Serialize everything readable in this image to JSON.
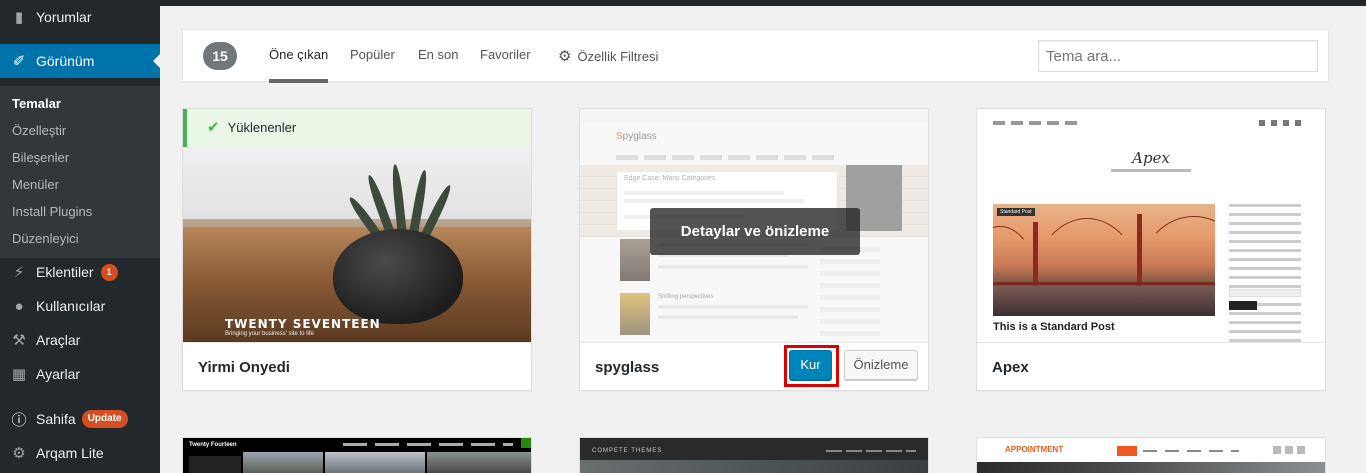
{
  "sidebar": {
    "comments": "Yorumlar",
    "appearance": "Görünüm",
    "appearance_sub": [
      "Temalar",
      "Özelleştir",
      "Bileşenler",
      "Menüler",
      "Install Plugins",
      "Düzenleyici"
    ],
    "plugins": "Eklentiler",
    "plugins_count": "1",
    "users": "Kullanıcılar",
    "tools": "Araçlar",
    "settings": "Ayarlar",
    "sahifa": "Sahifa",
    "sahifa_badge": "Update",
    "arqam": "Arqam Lite"
  },
  "filter": {
    "count": "15",
    "tabs": [
      "Öne çıkan",
      "Popüler",
      "En son",
      "Favoriler"
    ],
    "feature_filter": "Özellik Filtresi",
    "search_placeholder": "Tema ara..."
  },
  "themes": [
    {
      "name": "Yirmi Onyedi",
      "installed_notice": "Yüklenenler",
      "screenshot_title": "TWENTY SEVENTEEN",
      "screenshot_tagline": "Bringing your business' site to life"
    },
    {
      "name": "spyglass",
      "screenshot_logo_mark": "S",
      "screenshot_logo_text": "pyglass",
      "screenshot_post": "Edge Case: Many Categories",
      "screenshot_post2": "Shifting perspectives",
      "details_label": "Detaylar ve önizleme",
      "install_label": "Kur",
      "preview_label": "Önizleme"
    },
    {
      "name": "Apex",
      "screenshot_logo": "Apex",
      "screenshot_chip": "Standard Post",
      "screenshot_post": "This is a Standard Post"
    }
  ],
  "bottom_row": [
    {
      "screenshot_title": "Twenty Fourteen"
    },
    {
      "screenshot_title": "COMPETE THEMES"
    },
    {
      "screenshot_title": "APPOINTMENT"
    }
  ],
  "colors": {
    "sidebar_bg": "#23282d",
    "active_menu": "#0073aa",
    "install_button": "#0085ba",
    "highlight_frame": "#dd0000",
    "installed_green": "#46b450"
  }
}
